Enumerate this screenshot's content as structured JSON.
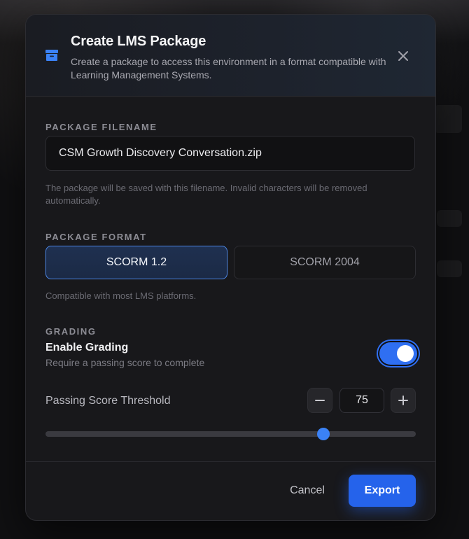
{
  "dialog": {
    "title": "Create LMS Package",
    "subtitle": "Create a package to access this environment in a format compatible with Learning Management Systems.",
    "header_icon": "archive-box-icon",
    "close_icon": "close-icon"
  },
  "filename": {
    "label": "PACKAGE FILENAME",
    "value": "CSM Growth Discovery Conversation.zip",
    "helper": "The package will be saved with this filename. Invalid characters will be removed automatically."
  },
  "format": {
    "label": "PACKAGE FORMAT",
    "options": [
      "SCORM 1.2",
      "SCORM 2004"
    ],
    "selected": "SCORM 1.2",
    "helper": "Compatible with most LMS platforms."
  },
  "grading": {
    "label": "GRADING",
    "title": "Enable Grading",
    "description": "Require a passing score to complete",
    "enabled": true,
    "threshold_label": "Passing Score Threshold",
    "threshold_value": "75",
    "slider_min": 0,
    "slider_max": 100,
    "slider_value": 75,
    "decrement_icon": "minus-icon",
    "increment_icon": "plus-icon"
  },
  "footer": {
    "cancel_label": "Cancel",
    "export_label": "Export"
  },
  "colors": {
    "accent": "#2563eb",
    "selected_border": "#4d88e8",
    "surface": "#18181b"
  }
}
